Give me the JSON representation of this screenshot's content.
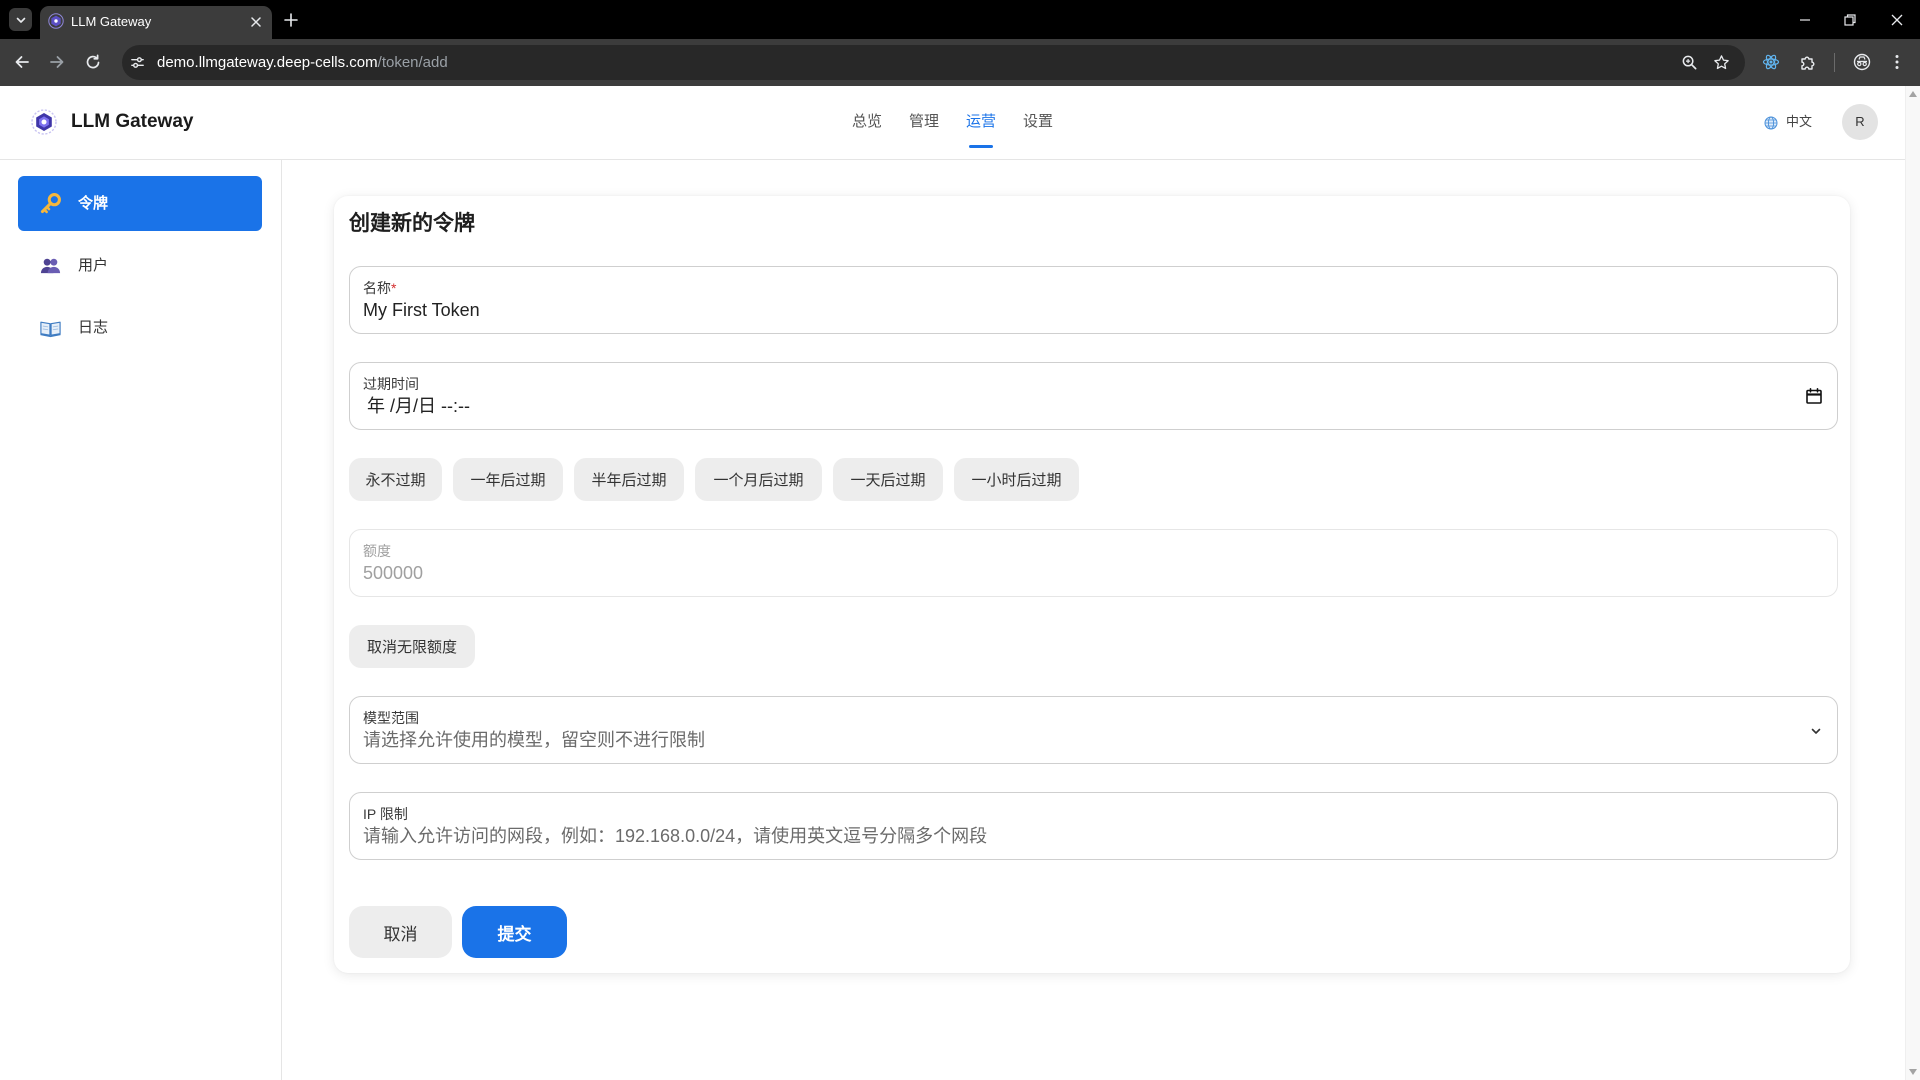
{
  "browser": {
    "tab_title": "LLM Gateway",
    "url_host": "demo.llmgateway.deep-cells.com",
    "url_path": "/token/add"
  },
  "header": {
    "app_name": "LLM Gateway",
    "nav": [
      {
        "label": "总览",
        "active": false
      },
      {
        "label": "管理",
        "active": false
      },
      {
        "label": "运营",
        "active": true
      },
      {
        "label": "设置",
        "active": false
      }
    ],
    "language": "中文",
    "avatar_initial": "R"
  },
  "sidebar": {
    "items": [
      {
        "label": "令牌",
        "icon": "key-icon",
        "active": true
      },
      {
        "label": "用户",
        "icon": "users-icon",
        "active": false
      },
      {
        "label": "日志",
        "icon": "book-icon",
        "active": false
      }
    ]
  },
  "form": {
    "title": "创建新的令牌",
    "name": {
      "label": "名称",
      "required_mark": "*",
      "value": "My First Token"
    },
    "expiry": {
      "label": "过期时间",
      "value": "年 /月/日 --:--"
    },
    "expiry_presets": [
      "永不过期",
      "一年后过期",
      "半年后过期",
      "一个月后过期",
      "一天后过期",
      "一小时后过期"
    ],
    "quota": {
      "label": "额度",
      "value": "500000",
      "disabled": true
    },
    "unlimited_quota_button": "取消无限额度",
    "models": {
      "label": "模型范围",
      "placeholder": "请选择允许使用的模型，留空则不进行限制"
    },
    "ip_limit": {
      "label": "IP 限制",
      "placeholder": "请输入允许访问的网段，例如：192.168.0.0/24，请使用英文逗号分隔多个网段"
    },
    "actions": {
      "cancel": "取消",
      "submit": "提交"
    }
  },
  "colors": {
    "primary": "#1a73e8",
    "required": "#d32f2f",
    "browser_frame": "#3c3c3c",
    "tab_strip": "#000000",
    "omnibox": "#282828"
  }
}
